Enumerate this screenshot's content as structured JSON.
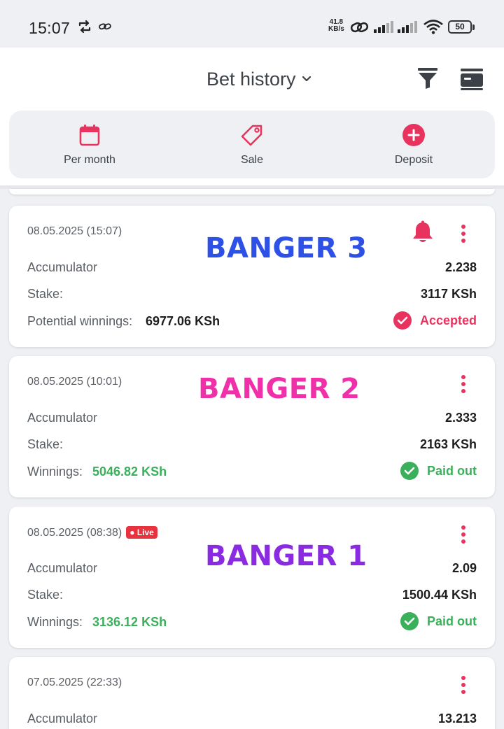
{
  "status_bar": {
    "time": "15:07",
    "net_speed_value": "41.8",
    "net_speed_unit": "KB/s",
    "battery": "50",
    "icons": [
      "sync-icon",
      "link-icon",
      "hotspot-icon",
      "signal-icon",
      "signal-icon",
      "wifi-icon",
      "battery-icon"
    ]
  },
  "header": {
    "title": "Bet history",
    "icons": [
      "chevron-down-icon",
      "filter-icon",
      "menu-icon"
    ]
  },
  "quick_actions": [
    {
      "label": "Per month",
      "icon": "calendar-icon"
    },
    {
      "label": "Sale",
      "icon": "tag-icon"
    },
    {
      "label": "Deposit",
      "icon": "plus-circle-icon"
    }
  ],
  "colors": {
    "accent": "#e8335e",
    "paid_out": "#3ab05a",
    "banger_3": "#2d50e6",
    "banger_2": "#f030a8",
    "banger_1": "#8a2be2"
  },
  "bets": [
    {
      "date": "08.05.2025 (15:07)",
      "banner": "BANGER 3",
      "type_label": "Accumulator",
      "odds": "2.238",
      "stake_label": "Stake:",
      "stake": "3117 KSh",
      "winnings_label": "Potential winnings:",
      "winnings": "6977.06 KSh",
      "status": "Accepted"
    },
    {
      "date": "08.05.2025 (10:01)",
      "banner": "BANGER 2",
      "type_label": "Accumulator",
      "odds": "2.333",
      "stake_label": "Stake:",
      "stake": "2163 KSh",
      "winnings_label": "Winnings:",
      "winnings": "5046.82 KSh",
      "status": "Paid out"
    },
    {
      "date": "08.05.2025 (08:38)",
      "live_badge": "Live",
      "banner": "BANGER 1",
      "type_label": "Accumulator",
      "odds": "2.09",
      "stake_label": "Stake:",
      "stake": "1500.44 KSh",
      "winnings_label": "Winnings:",
      "winnings": "3136.12 KSh",
      "status": "Paid out"
    },
    {
      "date": "07.05.2025 (22:33)",
      "type_label": "Accumulator",
      "odds": "13.213"
    }
  ]
}
